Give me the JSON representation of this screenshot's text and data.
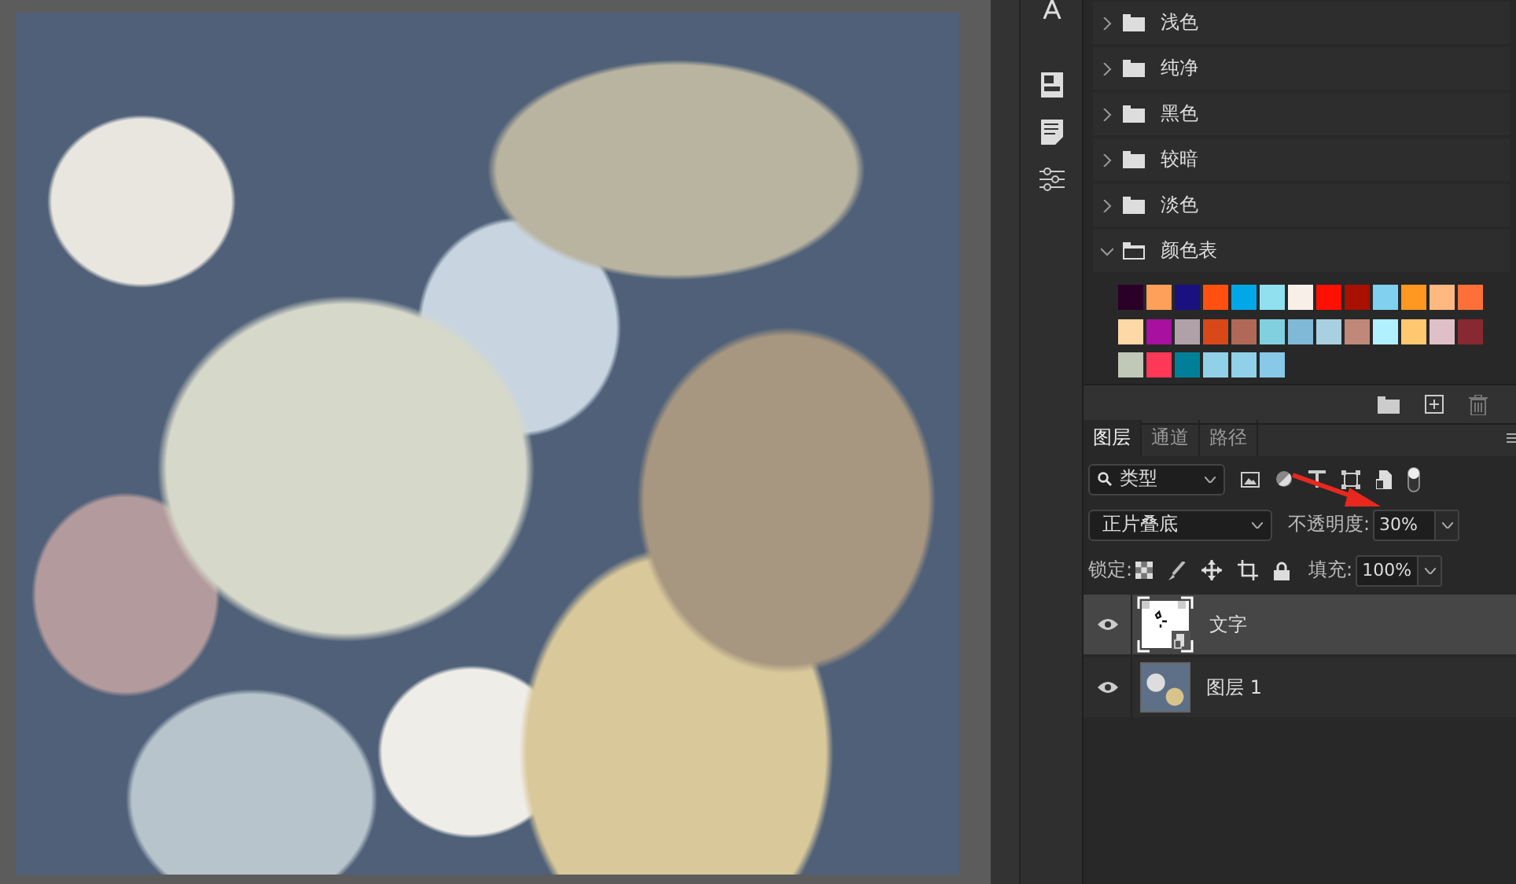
{
  "swatches": {
    "groups": [
      {
        "name": "浅色",
        "expanded": false
      },
      {
        "name": "纯净",
        "expanded": false
      },
      {
        "name": "黑色",
        "expanded": false
      },
      {
        "name": "较暗",
        "expanded": false
      },
      {
        "name": "淡色",
        "expanded": false
      },
      {
        "name": "颜色表",
        "expanded": true,
        "colors": [
          {
            "color": "#2a0028"
          },
          {
            "color": "#ffa05a"
          },
          {
            "color": "#1a1080"
          },
          {
            "color": "#ff5010"
          },
          {
            "color": "#00a8e8"
          },
          {
            "color": "#90e0f0"
          },
          {
            "color": "#f8f0e8"
          },
          {
            "color": "#ff1000"
          },
          {
            "color": "#a81000"
          },
          {
            "color": "#80d0f0"
          },
          {
            "color": "#ff9820"
          },
          {
            "color": "#ffb880"
          },
          {
            "color": "#ff7038"
          },
          {
            "color": "#ffd8a8"
          },
          {
            "color": "#a810a0"
          },
          {
            "color": "#b0a0a8"
          },
          {
            "color": "#d84818"
          },
          {
            "color": "#b06858"
          },
          {
            "color": "#80d0e0"
          },
          {
            "color": "#80b8d8"
          },
          {
            "color": "#a8d0e0"
          },
          {
            "color": "#c08878"
          },
          {
            "color": "#b0f0ff"
          },
          {
            "color": "#ffc870"
          },
          {
            "color": "#e0c0c8"
          },
          {
            "color": "#882830"
          },
          {
            "color": "#c0c8b8"
          },
          {
            "color": "#ff3858"
          },
          {
            "color": "#008098"
          },
          {
            "color": "#90d0e8"
          },
          {
            "color": "#90d0e8"
          },
          {
            "color": "#88c8e8"
          }
        ]
      }
    ]
  },
  "tabs": [
    {
      "label": "图层",
      "selected": true
    },
    {
      "label": "通道",
      "selected": false
    },
    {
      "label": "路径",
      "selected": false
    }
  ],
  "filter": {
    "value": "类型"
  },
  "blend_mode": {
    "value": "正片叠底"
  },
  "opacity": {
    "label": "不透明度:",
    "value": "30%"
  },
  "lock": {
    "label": "锁定:"
  },
  "fill": {
    "label": "填充:",
    "value": "100%"
  },
  "layers": [
    {
      "name": "文字",
      "kind": "smart",
      "visible": true,
      "selected": true
    },
    {
      "name": "图层 1",
      "kind": "photo",
      "visible": true,
      "selected": false
    }
  ]
}
